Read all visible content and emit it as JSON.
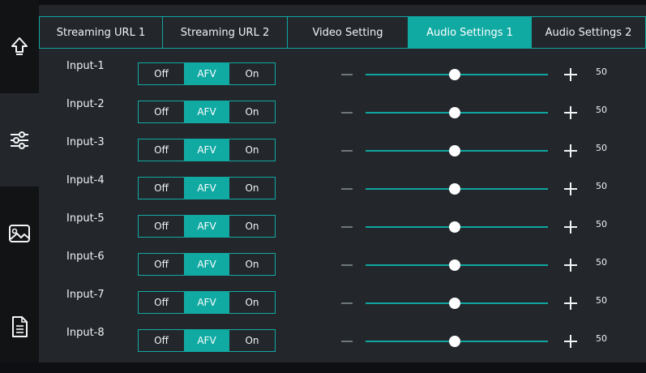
{
  "sidebar": {
    "items": [
      {
        "name": "upload",
        "icon": "upload-arrow-icon",
        "active": false
      },
      {
        "name": "settings",
        "icon": "sliders-icon",
        "active": true
      },
      {
        "name": "image",
        "icon": "image-icon",
        "active": false
      },
      {
        "name": "document",
        "icon": "document-icon",
        "active": false
      }
    ]
  },
  "tabs": [
    {
      "label": "Streaming URL 1",
      "active": false
    },
    {
      "label": "Streaming URL 2",
      "active": false
    },
    {
      "label": "Video Setting",
      "active": false
    },
    {
      "label": "Audio Settings 1",
      "active": true
    },
    {
      "label": "Audio Settings 2",
      "active": false
    }
  ],
  "mode_options": [
    "Off",
    "AFV",
    "On"
  ],
  "rows": [
    {
      "label": "Input-1",
      "mode": "AFV",
      "minus": "—",
      "plus": "+",
      "volume": 50,
      "value_text": "50"
    },
    {
      "label": "Input-2",
      "mode": "AFV",
      "minus": "—",
      "plus": "+",
      "volume": 50,
      "value_text": "50"
    },
    {
      "label": "Input-3",
      "mode": "AFV",
      "minus": "—",
      "plus": "+",
      "volume": 50,
      "value_text": "50"
    },
    {
      "label": "Input-4",
      "mode": "AFV",
      "minus": "—",
      "plus": "+",
      "volume": 50,
      "value_text": "50"
    },
    {
      "label": "Input-5",
      "mode": "AFV",
      "minus": "—",
      "plus": "+",
      "volume": 50,
      "value_text": "50"
    },
    {
      "label": "Input-6",
      "mode": "AFV",
      "minus": "—",
      "plus": "+",
      "volume": 50,
      "value_text": "50"
    },
    {
      "label": "Input-7",
      "mode": "AFV",
      "minus": "—",
      "plus": "+",
      "volume": 50,
      "value_text": "50"
    },
    {
      "label": "Input-8",
      "mode": "AFV",
      "minus": "—",
      "plus": "+",
      "volume": 50,
      "value_text": "50"
    }
  ],
  "slider": {
    "min": 0,
    "max": 100
  },
  "colors": {
    "accent": "#11aaa3",
    "panel": "#23272b",
    "background": "#0d0f12"
  }
}
